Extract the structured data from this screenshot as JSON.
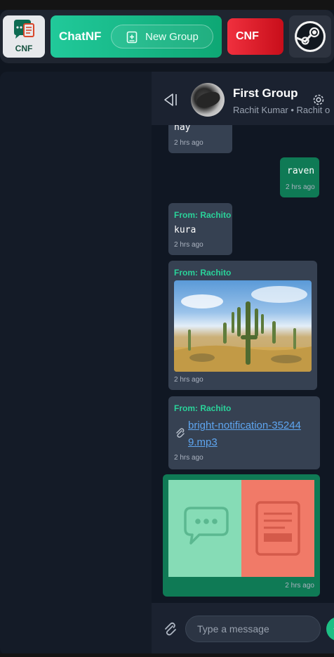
{
  "nav": {
    "logo_label": "CNF",
    "chatnf_label": "ChatNF",
    "new_group_label": "New Group",
    "cnf_label": "CNF"
  },
  "chat": {
    "group_name": "First Group",
    "members": "Rachit Kumar • Rachit o",
    "composer_placeholder": "Type a message"
  },
  "messages": [
    {
      "type": "received",
      "from": "",
      "text": "nay",
      "time": "2 hrs ago"
    },
    {
      "type": "sent",
      "from": "",
      "text": "raven",
      "time": "2 hrs ago"
    },
    {
      "type": "received",
      "from": "From: Rachito",
      "text": "kura",
      "time": "2 hrs ago"
    },
    {
      "type": "received-image",
      "from": "From: Rachito",
      "text": "",
      "time": "2 hrs ago"
    },
    {
      "type": "received-file",
      "from": "From: Rachito",
      "text": "bright-notification-352449.mp3",
      "time": "2 hrs ago"
    },
    {
      "type": "sent-preview",
      "from": "",
      "text": "",
      "time": "2 hrs ago"
    }
  ],
  "colors": {
    "accent_green": "#0ea774",
    "accent_red": "#c80e1a",
    "sent_bubble": "#0f7a55",
    "received_bubble": "#364152",
    "link": "#5ea5ef"
  },
  "icons": [
    "logo-icon",
    "new-group-icon",
    "steam-icon",
    "collapse-sidebar-icon",
    "gear-icon",
    "paperclip-icon",
    "chat-bubble-icon",
    "document-icon",
    "send-icon"
  ]
}
